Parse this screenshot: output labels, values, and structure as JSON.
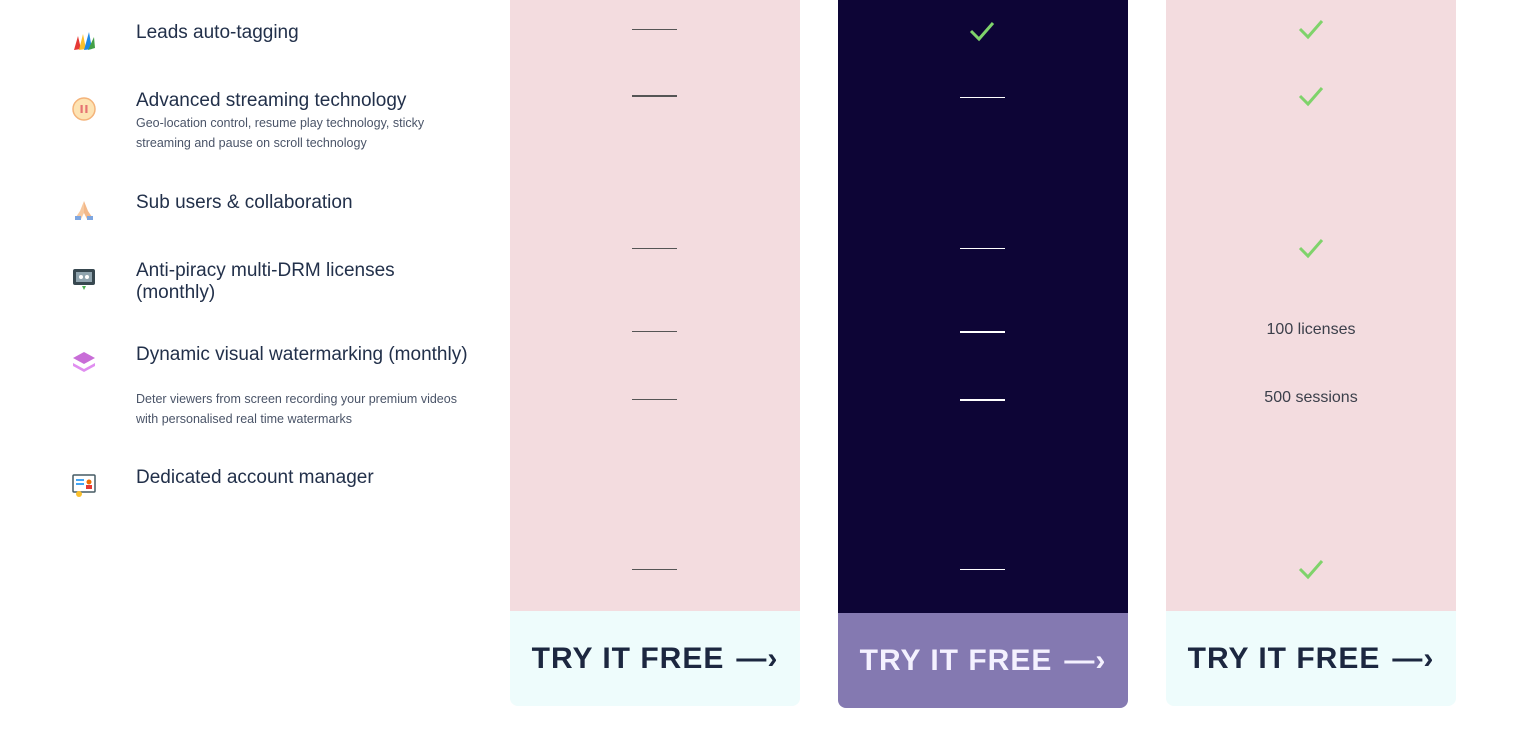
{
  "features": [
    {
      "title": "Leads auto-tagging",
      "desc": "",
      "icon": "tags-icon"
    },
    {
      "title": "Advanced streaming technology",
      "desc": "Geo-location control, resume play technology, sticky streaming and pause on scroll technology",
      "icon": "pause-icon"
    },
    {
      "title": "Sub users & collaboration",
      "desc": "",
      "icon": "hands-icon"
    },
    {
      "title": "Anti-piracy multi-DRM licenses (monthly)",
      "desc": "",
      "icon": "shield-screen-icon"
    },
    {
      "title": "Dynamic visual watermarking (monthly)",
      "desc": "Deter viewers from screen recording your premium videos with personalised real time watermarks",
      "icon": "layers-icon"
    },
    {
      "title": "Dedicated account manager",
      "desc": "",
      "icon": "manager-icon"
    }
  ],
  "plans": [
    {
      "cells": [
        "—",
        "—",
        "—",
        "—",
        "—",
        "—"
      ],
      "cta": "TRY IT FREE"
    },
    {
      "cells": [
        "✓",
        "—",
        "—",
        "—",
        "—",
        "—"
      ],
      "cta": "TRY IT FREE"
    },
    {
      "cells": [
        "✓",
        "✓",
        "✓",
        "100 licenses",
        "500 sessions",
        "✓"
      ],
      "cta": "TRY IT FREE"
    }
  ],
  "cta_arrow": "—›",
  "colors": {
    "pink": "#f3dcdf",
    "dark": "#0d0536",
    "check": "#7fd36b",
    "cta_light": "#eefcfc",
    "cta_purple": "#8479b1"
  }
}
